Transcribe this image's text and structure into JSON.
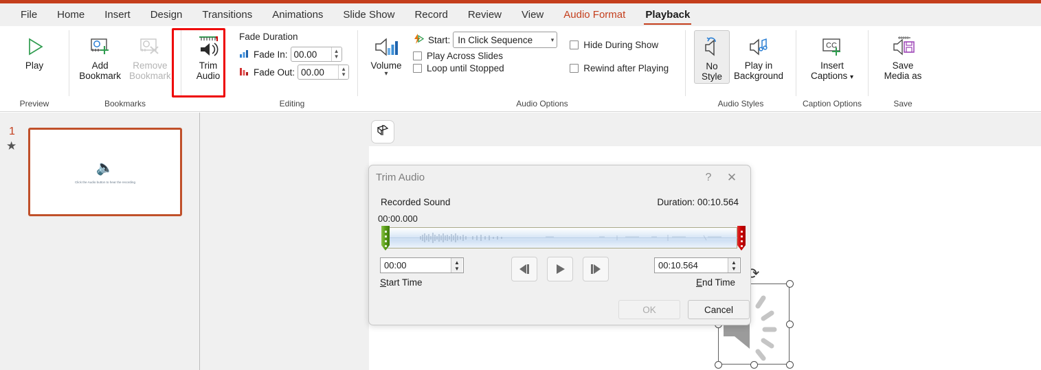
{
  "tabs": [
    {
      "label": "File",
      "state": "normal"
    },
    {
      "label": "Home",
      "state": "normal"
    },
    {
      "label": "Insert",
      "state": "normal"
    },
    {
      "label": "Design",
      "state": "normal"
    },
    {
      "label": "Transitions",
      "state": "normal"
    },
    {
      "label": "Animations",
      "state": "normal"
    },
    {
      "label": "Slide Show",
      "state": "normal"
    },
    {
      "label": "Record",
      "state": "normal"
    },
    {
      "label": "Review",
      "state": "normal"
    },
    {
      "label": "View",
      "state": "normal"
    },
    {
      "label": "Audio Format",
      "state": "contextual"
    },
    {
      "label": "Playback",
      "state": "active"
    }
  ],
  "ribbon": {
    "preview": {
      "group_label": "Preview",
      "play_label": "Play"
    },
    "bookmarks": {
      "group_label": "Bookmarks",
      "add_label_line1": "Add",
      "add_label_line2": "Bookmark",
      "remove_label_line1": "Remove",
      "remove_label_line2": "Bookmark"
    },
    "editing": {
      "group_label": "Editing",
      "trim_label_line1": "Trim",
      "trim_label_line2": "Audio",
      "fade_duration_title": "Fade Duration",
      "fade_in_label": "Fade In:",
      "fade_in_value": "00.00",
      "fade_out_label": "Fade Out:",
      "fade_out_value": "00.00",
      "highlight_color": "#ee0000"
    },
    "audio_options": {
      "group_label": "Audio Options",
      "volume_label": "Volume",
      "start_label": "Start:",
      "start_value": "In Click Sequence",
      "play_across_slides": "Play Across Slides",
      "loop_until_stopped": "Loop until Stopped",
      "hide_during_show": "Hide During Show",
      "rewind_after_playing": "Rewind after Playing"
    },
    "audio_styles": {
      "group_label": "Audio Styles",
      "no_style_line1": "No",
      "no_style_line2": "Style",
      "play_bg_line1": "Play in",
      "play_bg_line2": "Background"
    },
    "caption_options": {
      "group_label": "Caption Options",
      "insert_line1": "Insert",
      "insert_line2": "Captions",
      "cc_text": "CC"
    },
    "save": {
      "group_label": "Save",
      "save_media_line1": "Save",
      "save_media_line2": "Media as"
    }
  },
  "thumbnail_pane": {
    "slide_number": "1",
    "slide_caption": "Click the Audio button to hear the recording",
    "selection_color": "#c0502a"
  },
  "dialog": {
    "title": "Trim Audio",
    "help_glyph": "?",
    "close_glyph": "✕",
    "sound_name": "Recorded Sound",
    "duration_label": "Duration: 00:10.564",
    "timecode_top": "00:00.000",
    "start_time_value": "00:00",
    "end_time_value": "00:10.564",
    "start_time_label_pre": "S",
    "start_time_label_post": "tart Time",
    "end_time_label_pre": "E",
    "end_time_label_post": "nd Time",
    "ok_label": "OK",
    "ok_enabled": false,
    "cancel_label": "Cancel",
    "start_marker_color": "#5a9e18",
    "end_marker_color": "#cc0000"
  },
  "canvas": {
    "designer_icon": "designer-ideas-icon"
  }
}
